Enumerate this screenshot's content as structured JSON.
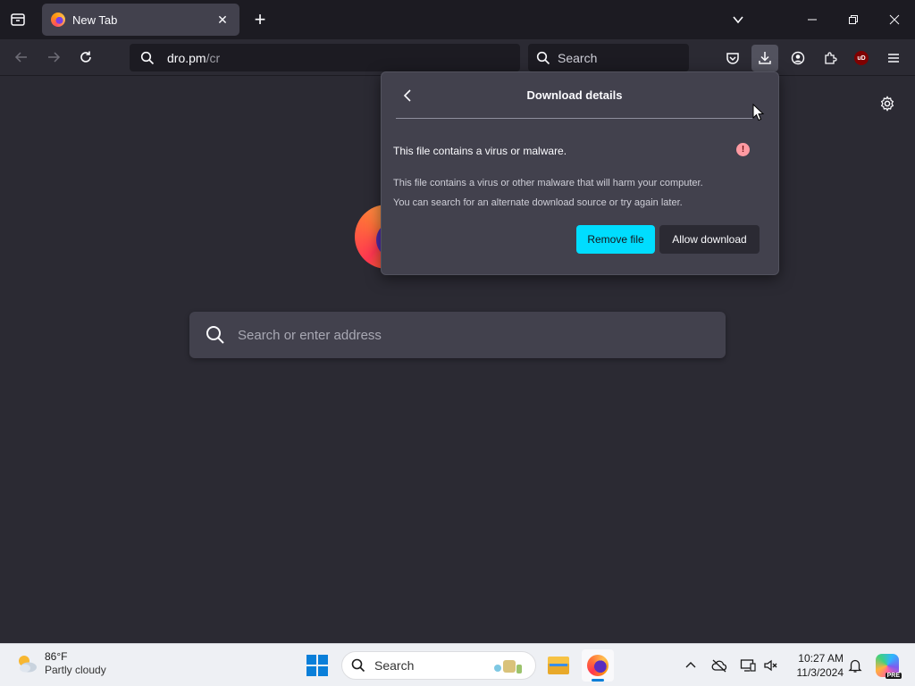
{
  "browser": {
    "tab": {
      "title": "New Tab",
      "close": "✕"
    },
    "new_tab": "+",
    "url": {
      "host": "dro.pm",
      "path": "/cr"
    },
    "search_placeholder": "Search"
  },
  "newtab_page": {
    "search_placeholder": "Search or enter address"
  },
  "download_panel": {
    "title": "Download details",
    "heading": "This file contains a virus or malware.",
    "warn_glyph": "!",
    "desc_line1": "This file contains a virus or other malware that will harm your computer.",
    "desc_line2": "You can search for an alternate download source or try again later.",
    "remove_label": "Remove file",
    "allow_label": "Allow download"
  },
  "toolbar": {
    "ublock_label": "uD"
  },
  "taskbar": {
    "weather": {
      "temp": "86°F",
      "desc": "Partly cloudy"
    },
    "search_label": "Search",
    "clock": {
      "time": "10:27 AM",
      "date": "11/3/2024"
    },
    "copilot_badge": "PRE"
  },
  "colors": {
    "accent": "#00ddff",
    "panel_bg": "#42414d",
    "chrome_bg": "#1c1b22",
    "content_bg": "#2b2a33"
  }
}
